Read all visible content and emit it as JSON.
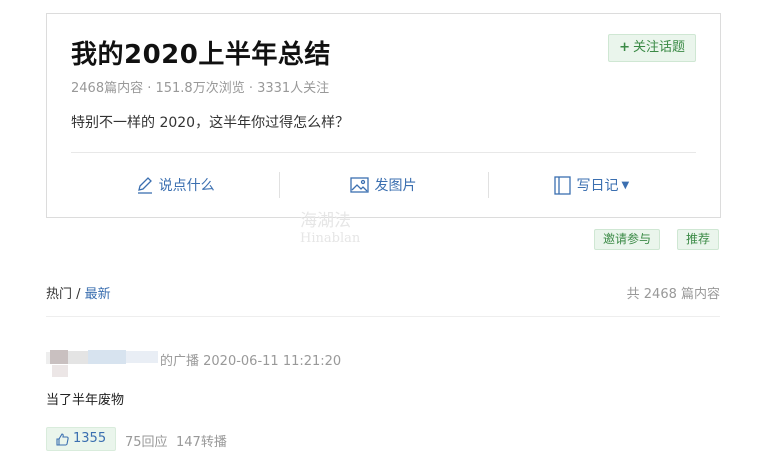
{
  "topic": {
    "title": "我的2020上半年总结",
    "follow_label": "关注话题",
    "meta": "2468篇内容 · 151.8万次浏览 · 3331人关注",
    "description": "特别不一样的 2020，这半年你过得怎么样？"
  },
  "actions": [
    {
      "label": "说点什么",
      "icon": "pencil-icon"
    },
    {
      "label": "发图片",
      "icon": "image-icon"
    },
    {
      "label": "写日记",
      "icon": "book-icon"
    }
  ],
  "watermark": {
    "line1": "海湖法",
    "line2": "Hinablan"
  },
  "tags": {
    "invite": "邀请参与",
    "recommend": "推荐"
  },
  "sort": {
    "hot": "热门",
    "separator": " / ",
    "latest": "最新"
  },
  "total_count": "共 2468 篇内容",
  "post": {
    "meta": "的广播 2020-06-11 11:21:20",
    "body": "当了半年废物",
    "likes": "1355",
    "replies": "75回应",
    "reposts": "147转播"
  },
  "colors": {
    "accent_green": "#3b8a46",
    "link_blue": "#3b6fb0",
    "muted": "#999999"
  }
}
